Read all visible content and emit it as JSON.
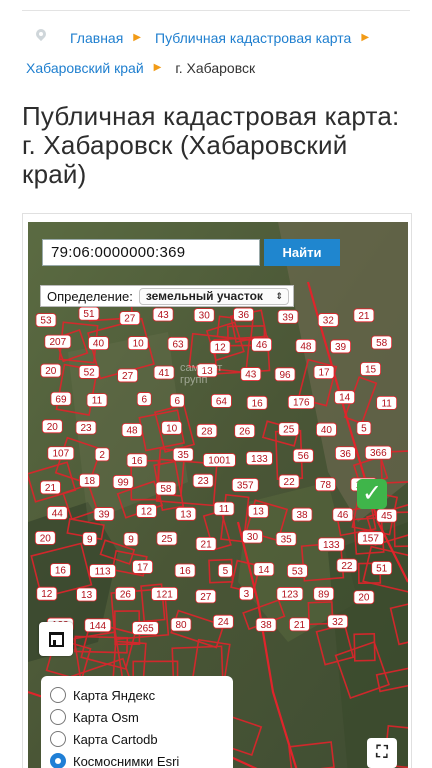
{
  "breadcrumbs": {
    "home": "Главная",
    "public_map": "Публичная кадастровая карта",
    "region": "Хабаровский край",
    "current": "г. Хабаровск",
    "separator": "▶"
  },
  "page_title": "Публичная кадастровая карта: г. Хабаровск (Хабаровский край)",
  "map": {
    "search": {
      "value": "79:06:0000000:369",
      "button": "Найти"
    },
    "definition": {
      "label": "Определение:",
      "selected": "земельный участок"
    },
    "watermark_line1": "самолет",
    "watermark_line2": "групп",
    "layers": [
      {
        "label": "Карта Яндекс",
        "selected": false
      },
      {
        "label": "Карта Osm",
        "selected": false
      },
      {
        "label": "Карта Cartodb",
        "selected": false
      },
      {
        "label": "Космоснимки Esri",
        "selected": true
      }
    ],
    "parcel_numbers": [
      "53",
      "51",
      "27",
      "43",
      "30",
      "36",
      "39",
      "32",
      "21",
      "207",
      "40",
      "10",
      "63",
      "12",
      "46",
      "48",
      "39",
      "58",
      "20",
      "52",
      "27",
      "41",
      "13",
      "43",
      "96",
      "17",
      "15",
      "69",
      "11",
      "6",
      "6",
      "64",
      "16",
      "176",
      "14",
      "11",
      "20",
      "23",
      "48",
      "10",
      "28",
      "26",
      "25",
      "40",
      "5",
      "107",
      "2",
      "16",
      "35",
      "1001",
      "133",
      "56",
      "36",
      "366",
      "21",
      "18",
      "99",
      "58",
      "23",
      "357",
      "22",
      "78",
      "182",
      "44",
      "39",
      "12",
      "13",
      "11",
      "13",
      "38",
      "46",
      "45",
      "20",
      "9",
      "9",
      "25",
      "21",
      "30",
      "35",
      "133",
      "157",
      "16",
      "113",
      "17",
      "16",
      "5",
      "14",
      "53",
      "22",
      "51",
      "12",
      "13",
      "26",
      "121",
      "27",
      "3",
      "123",
      "89",
      "20",
      "123",
      "144",
      "265",
      "80",
      "24",
      "38",
      "21",
      "32"
    ]
  },
  "icons": {
    "breadcrumb_pin": "location-pin-icon",
    "check": "check-mark-icon",
    "fullscreen": "expand-icon",
    "map_logo": "map-logo-icon"
  },
  "colors": {
    "link": "#1f7fcf",
    "separator": "#f29b16",
    "search_button": "#1f86cf",
    "parcel_outline": "#e0242b",
    "check_badge": "#3fb54a",
    "radio_selected": "#1f7fd6"
  }
}
